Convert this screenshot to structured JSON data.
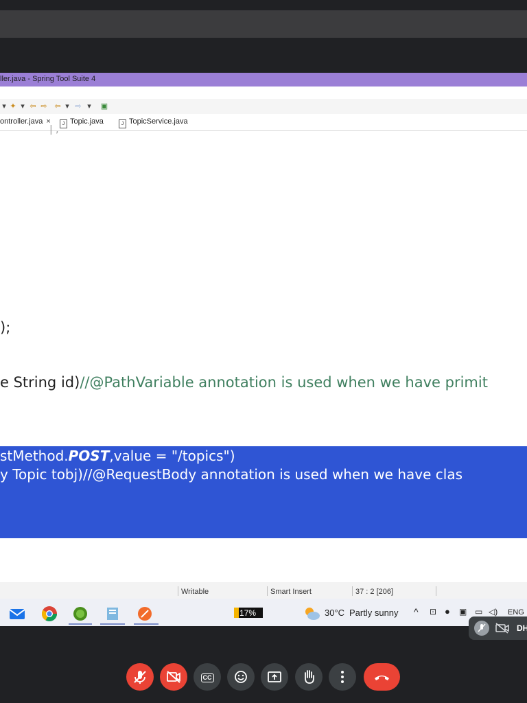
{
  "window": {
    "title": "ller.java - Spring Tool Suite 4"
  },
  "toolbar": {
    "icons": [
      "dropdown-icon",
      "bug-icon",
      "back-arrow-icon",
      "forward-arrow-icon",
      "left-arrow-icon",
      "right-arrow-icon",
      "open-icon"
    ]
  },
  "tabs": [
    {
      "label": "ontroller.java",
      "active": true,
      "close": "×"
    },
    {
      "label": "Topic.java",
      "active": false
    },
    {
      "label": "TopicService.java",
      "active": false
    }
  ],
  "editor": {
    "line_top": "|     ,",
    "line_close": ");",
    "line_pathvar_code": "e String id)",
    "line_pathvar_comment": "//@PathVariable annotation is used when we have primit",
    "sel_line1_a": "stMethod.",
    "sel_line1_b": "POST",
    "sel_line1_c": ",value = \"/topics\")",
    "sel_line2": "y Topic tobj)//@RequestBody annotation is used when we have clas"
  },
  "statusbar": {
    "mode": "Writable",
    "insert": "Smart Insert",
    "position": "37 : 2 [206]"
  },
  "taskbar": {
    "apps": [
      "mail-icon",
      "chrome-icon",
      "spring-tool-suite-icon",
      "notepad-icon",
      "orange-app-icon"
    ],
    "battery": "17%",
    "weather_temp": "30°C",
    "weather_desc": "Partly sunny",
    "lang": "ENG"
  },
  "meet": {
    "self_label": "DH",
    "controls": [
      "mic-off-icon",
      "camera-off-icon",
      "captions-icon",
      "emoji-icon",
      "present-icon",
      "raise-hand-icon",
      "more-icon",
      "end-call-icon"
    ],
    "captions_text": "CC"
  },
  "colors": {
    "title_bar": "#9b7fd6",
    "selection": "#2f55d4",
    "end_call": "#ea4335",
    "comment": "#3f7f5f"
  }
}
